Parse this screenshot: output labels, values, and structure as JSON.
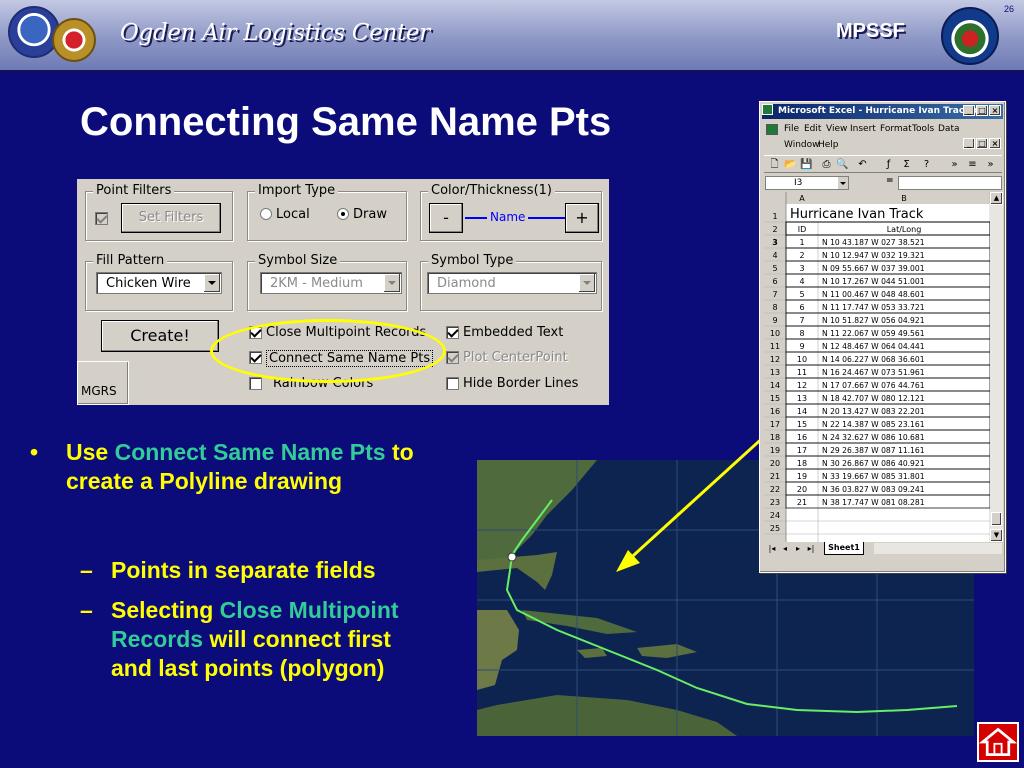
{
  "header": {
    "title": "Ogden Air Logistics Center",
    "right_label": "MPSSF",
    "slide_number": "26"
  },
  "slide_title": "Connecting Same Name Pts",
  "dialog": {
    "point_filters": {
      "label": "Point Filters",
      "set_filters_button": "Set Filters",
      "checked": true
    },
    "import_type": {
      "label": "Import Type",
      "options": [
        "Local",
        "Draw"
      ],
      "selected": "Draw"
    },
    "color_thickness": {
      "label": "Color/Thickness(1)",
      "minus": "-",
      "plus": "+",
      "name_label": "Name",
      "line_color": "#0000ff"
    },
    "fill_pattern": {
      "label": "Fill Pattern",
      "value": "Chicken Wire"
    },
    "symbol_size": {
      "label": "Symbol Size",
      "value": "2KM -  Medium"
    },
    "symbol_type": {
      "label": "Symbol Type",
      "value": "Diamond"
    },
    "create_button": "Create!",
    "mgrs_tab": "MGRS",
    "options": {
      "close_multipoint": {
        "label": "Close Multipoint Records",
        "checked": true
      },
      "embedded_text": {
        "label": "Embedded Text",
        "checked": true
      },
      "connect_same_name": {
        "label": "Connect Same Name Pts",
        "checked": true
      },
      "plot_centerpoint": {
        "label": "Plot CenterPoint",
        "checked": true,
        "disabled": true
      },
      "rainbow_colors": {
        "label": "Rainbow Colors",
        "checked": false
      },
      "hide_border_lines": {
        "label": "Hide Border Lines",
        "checked": false
      }
    }
  },
  "bullets": {
    "main": {
      "prefix": "Use ",
      "highlight": "Connect Same Name Pts",
      "suffix": " to create a Polyline drawing"
    },
    "sub1": "Points in separate fields",
    "sub2": {
      "prefix": "Selecting ",
      "highlight": "Close Multipoint Records",
      "suffix": " will connect first and last points (polygon)"
    }
  },
  "excel": {
    "title": "Microsoft Excel - Hurricane Ivan Track.xls",
    "menu_row1": [
      "File",
      "Edit",
      "View",
      "Insert",
      "Format",
      "Tools",
      "Data"
    ],
    "menu_row2": [
      "Window",
      "Help"
    ],
    "name_box": "I3",
    "formula_eq": "=",
    "columns": [
      "A",
      "B"
    ],
    "sheet_title": "Hurricane Ivan Track",
    "headers": [
      "ID",
      "Lat/Long"
    ],
    "rows": [
      [
        "1",
        "N  10 43.187   W  027 38.521"
      ],
      [
        "2",
        "N  10 12.947   W  032 19.321"
      ],
      [
        "3",
        "N  09 55.667   W  037 39.001"
      ],
      [
        "4",
        "N  10 17.267   W  044 51.001"
      ],
      [
        "5",
        "N  11 00.467   W  048 48.601"
      ],
      [
        "6",
        "N  11 17.747   W  053 33.721"
      ],
      [
        "7",
        "N  10 51.827   W  056 04.921"
      ],
      [
        "8",
        "N  11 22.067   W  059 49.561"
      ],
      [
        "9",
        "N  12 48.467   W  064 04.441"
      ],
      [
        "10",
        "N  14 06.227   W  068 36.601"
      ],
      [
        "11",
        "N  16 24.467   W  073 51.961"
      ],
      [
        "12",
        "N  17 07.667   W  076 44.761"
      ],
      [
        "13",
        "N  18 42.707   W  080 12.121"
      ],
      [
        "14",
        "N  20 13.427   W  083 22.201"
      ],
      [
        "15",
        "N  22 14.387   W  085 23.161"
      ],
      [
        "16",
        "N  24 32.627   W  086 10.681"
      ],
      [
        "17",
        "N  29 26.387   W  087 11.161"
      ],
      [
        "18",
        "N  30 26.867   W  086 40.921"
      ],
      [
        "19",
        "N  33 19.667   W  085 31.801"
      ],
      [
        "20",
        "N  36 03.827   W  083 09.241"
      ],
      [
        "21",
        "N  38 17.747   W  081 08.281"
      ]
    ],
    "row_numbers": [
      "1",
      "2",
      "3",
      "4",
      "5",
      "6",
      "7",
      "8",
      "9",
      "10",
      "11",
      "12",
      "13",
      "14",
      "15",
      "16",
      "17",
      "18",
      "19",
      "20",
      "21",
      "22",
      "23",
      "24",
      "25"
    ],
    "sheet_tab": "Sheet1"
  },
  "colors": {
    "background": "#0b0b7a",
    "title": "#ffffff",
    "bullet_text": "#ffff00",
    "highlight": "#33cc99",
    "ellipse": "#ffff00",
    "arrow": "#ffff00",
    "track": "#66ee66"
  }
}
